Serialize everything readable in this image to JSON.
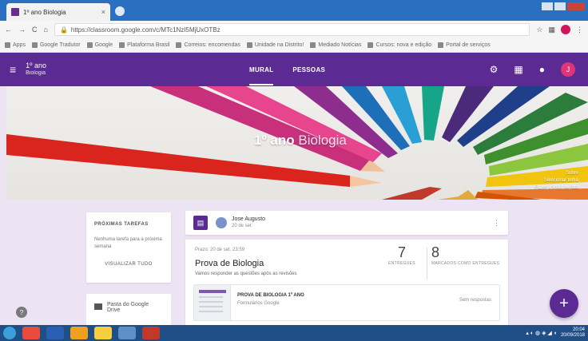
{
  "browser": {
    "tab_title": "1º ano Biologia",
    "url": "https://classroom.google.com/c/MTc1NzI5MjUxOTBz",
    "bookmarks": [
      "Apps",
      "Google Tradutor",
      "Google",
      "Plataforma Brasil",
      "Correios: encomendas",
      "Unidade na Distrito!",
      "Mediado Notícias",
      "Cursos: nova e edição",
      "Portal de serviços"
    ]
  },
  "header": {
    "class_title": "1º ano",
    "class_subtitle": "Biologia",
    "tabs": [
      "MURAL",
      "PESSOAS"
    ],
    "user_initial": "J"
  },
  "banner": {
    "title_bold": "1º ano",
    "title_light": "Biologia",
    "links": [
      "Sobre",
      "Selecionar tema",
      "Fazer upload de foto"
    ]
  },
  "upcoming": {
    "heading": "PRÓXIMAS TAREFAS",
    "text": "Nenhuma tarefa para a próxima semana",
    "link": "VISUALIZAR TUDO"
  },
  "drive": {
    "label": "Pasta do Google Drive"
  },
  "post": {
    "author": "Jose Augusto",
    "date": "20 de set"
  },
  "assignment": {
    "due": "Prazo: 20 de set. 23:59",
    "title": "Prova de Biologia",
    "description": "Vamos responder as questões após as revisões",
    "stats": [
      {
        "value": "7",
        "label": "ENTREGUES"
      },
      {
        "value": "8",
        "label": "MARCADOS COMO ENTREGUES"
      }
    ],
    "form_title": "PROVA DE BIOLOGIA 1º ANO",
    "form_source": "Formulários Google",
    "form_status": "Sem respostas"
  },
  "taskbar": {
    "time": "20:04",
    "date": "20/09/2018"
  }
}
